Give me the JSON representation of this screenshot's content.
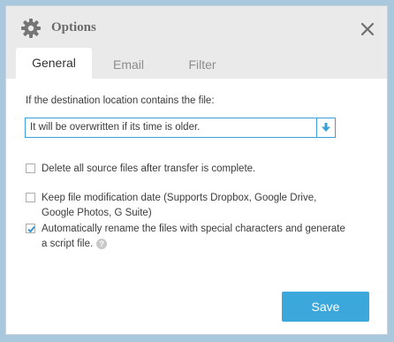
{
  "dialog": {
    "title": "Options"
  },
  "tabs": [
    {
      "label": "General",
      "active": true
    },
    {
      "label": "Email",
      "active": false
    },
    {
      "label": "Filter",
      "active": false
    }
  ],
  "general": {
    "question": "If the destination location contains the file:",
    "select_value": "It will be overwritten if its time is older.",
    "options": [
      {
        "label": "Delete all source files after transfer is complete.",
        "checked": false
      },
      {
        "label": "Keep file modification date (Supports Dropbox, Google Drive, Google Photos, G Suite)",
        "checked": false
      },
      {
        "label": "Automatically rename the files with special characters and generate a script file.",
        "checked": true
      }
    ],
    "help_glyph": "?"
  },
  "buttons": {
    "save_label": "Save"
  },
  "colors": {
    "accent": "#3ba7db",
    "titlebar": "#eaeaea",
    "background": "#a9c7dd"
  },
  "icons": {
    "title": "gear-icon",
    "close": "close-icon",
    "dropdown": "arrow-down-icon",
    "check": "checkmark-icon",
    "help": "help-icon"
  }
}
